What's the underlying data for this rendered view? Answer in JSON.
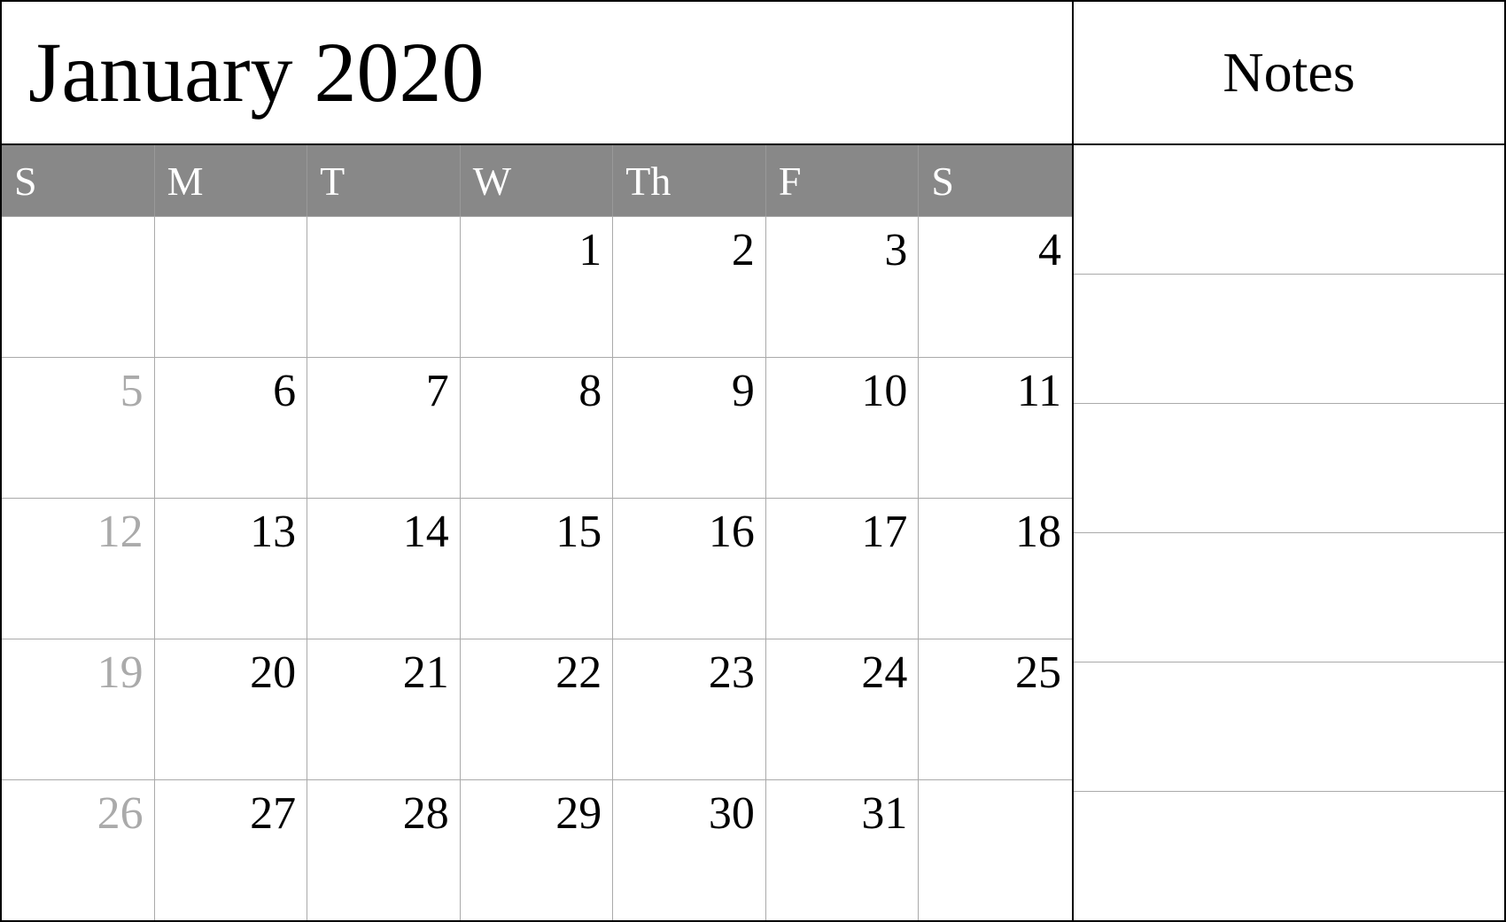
{
  "header": {
    "title": "January 2020"
  },
  "notes": {
    "title": "Notes"
  },
  "dayHeaders": [
    {
      "label": "S",
      "id": "sunday"
    },
    {
      "label": "M",
      "id": "monday"
    },
    {
      "label": "T",
      "id": "tuesday"
    },
    {
      "label": "W",
      "id": "wednesday"
    },
    {
      "label": "Th",
      "id": "thursday"
    },
    {
      "label": "F",
      "id": "friday"
    },
    {
      "label": "S",
      "id": "saturday"
    }
  ],
  "weeks": [
    [
      {
        "day": "",
        "type": "empty"
      },
      {
        "day": "",
        "type": "empty"
      },
      {
        "day": "",
        "type": "empty"
      },
      {
        "day": "1",
        "type": "normal"
      },
      {
        "day": "2",
        "type": "normal"
      },
      {
        "day": "3",
        "type": "normal"
      },
      {
        "day": "4",
        "type": "normal"
      }
    ],
    [
      {
        "day": "5",
        "type": "greyed"
      },
      {
        "day": "6",
        "type": "normal"
      },
      {
        "day": "7",
        "type": "normal"
      },
      {
        "day": "8",
        "type": "normal"
      },
      {
        "day": "9",
        "type": "normal"
      },
      {
        "day": "10",
        "type": "normal"
      },
      {
        "day": "11",
        "type": "normal"
      }
    ],
    [
      {
        "day": "12",
        "type": "greyed"
      },
      {
        "day": "13",
        "type": "normal"
      },
      {
        "day": "14",
        "type": "normal"
      },
      {
        "day": "15",
        "type": "normal"
      },
      {
        "day": "16",
        "type": "normal"
      },
      {
        "day": "17",
        "type": "normal"
      },
      {
        "day": "18",
        "type": "normal"
      }
    ],
    [
      {
        "day": "19",
        "type": "greyed"
      },
      {
        "day": "20",
        "type": "normal"
      },
      {
        "day": "21",
        "type": "normal"
      },
      {
        "day": "22",
        "type": "normal"
      },
      {
        "day": "23",
        "type": "normal"
      },
      {
        "day": "24",
        "type": "normal"
      },
      {
        "day": "25",
        "type": "normal"
      }
    ],
    [
      {
        "day": "26",
        "type": "greyed"
      },
      {
        "day": "27",
        "type": "normal"
      },
      {
        "day": "28",
        "type": "normal"
      },
      {
        "day": "29",
        "type": "normal"
      },
      {
        "day": "30",
        "type": "normal"
      },
      {
        "day": "31",
        "type": "normal"
      },
      {
        "day": "",
        "type": "empty"
      }
    ]
  ]
}
